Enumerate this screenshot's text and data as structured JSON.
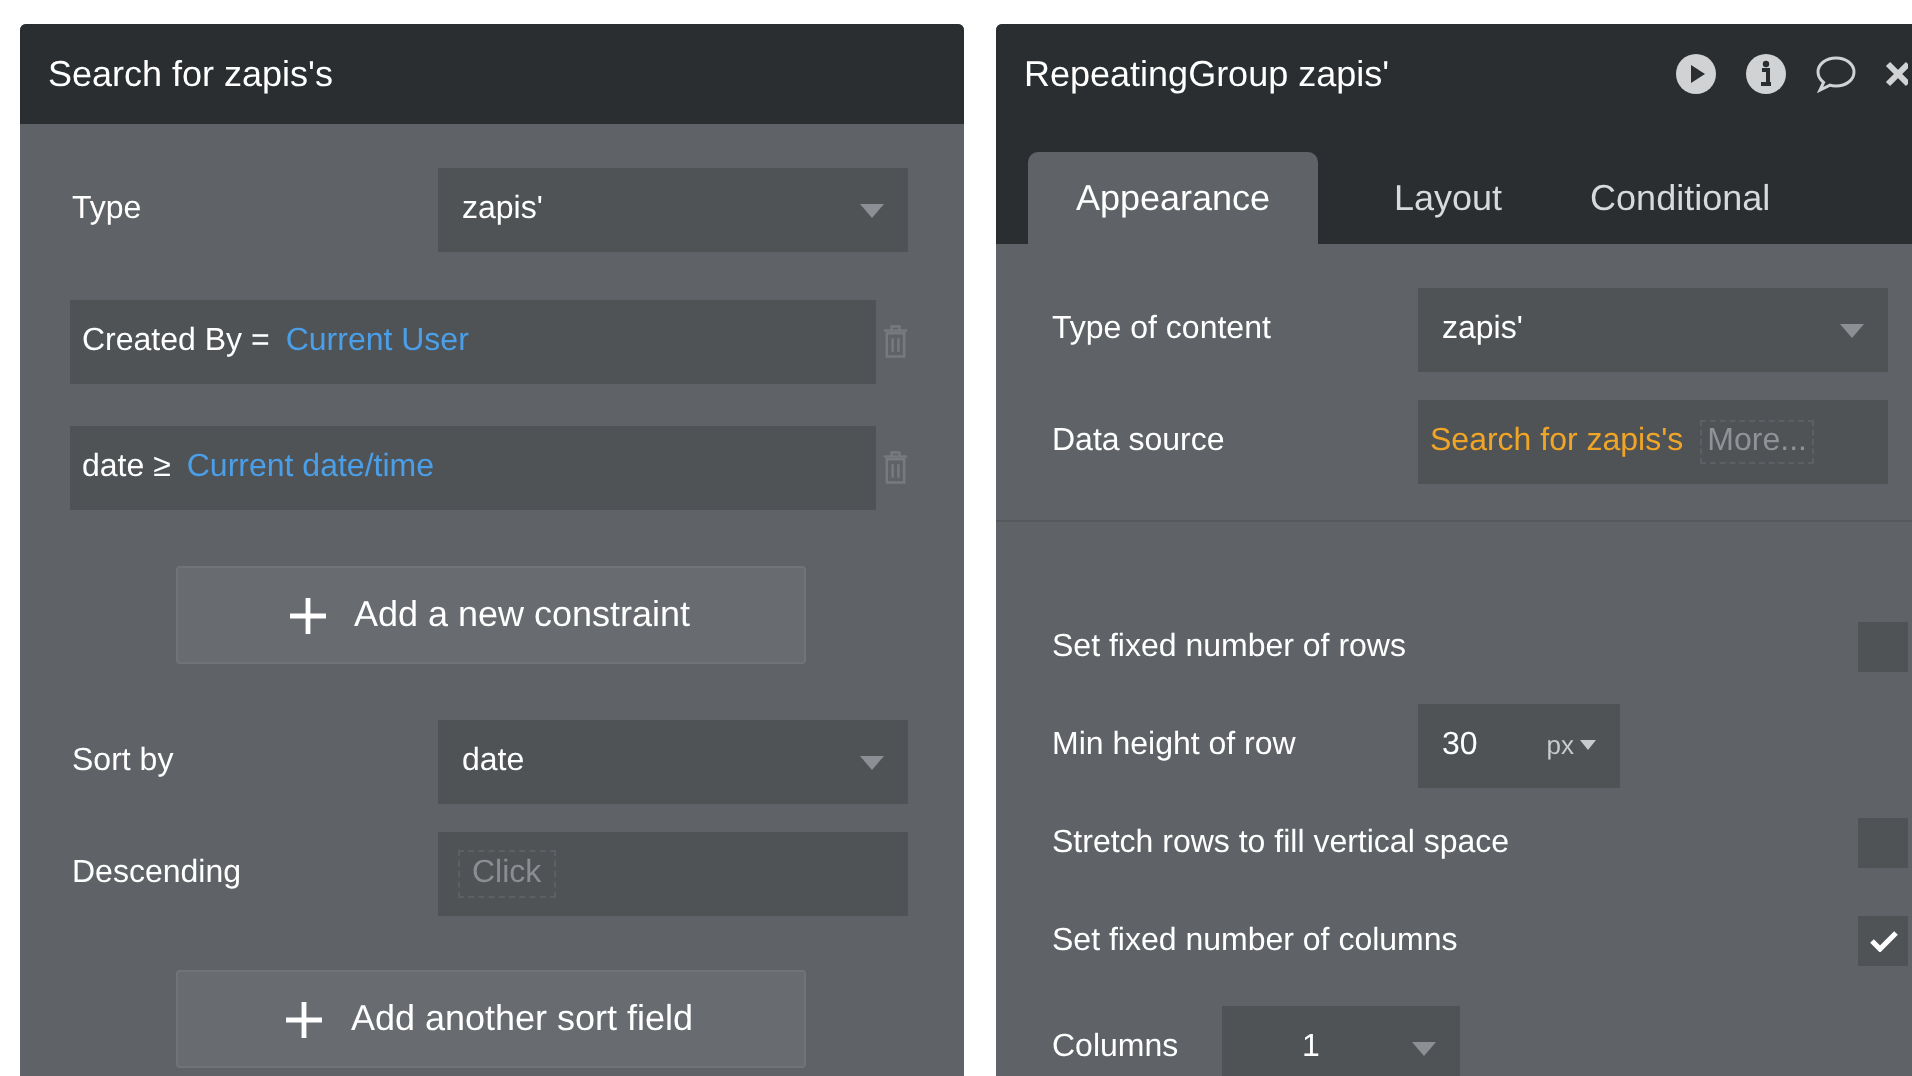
{
  "search_panel": {
    "title": "Search for zapis's",
    "type": {
      "label": "Type",
      "value": "zapis'"
    },
    "constraints": [
      {
        "label": "Created By =",
        "value": "Current User"
      },
      {
        "label": "date ≥",
        "value": "Current date/time"
      }
    ],
    "add_constraint_button": "Add a new constraint",
    "sort_by": {
      "label": "Sort by",
      "value": "date"
    },
    "descending": {
      "label": "Descending",
      "value": "Click"
    },
    "add_sort_button": "Add another sort field"
  },
  "element_panel": {
    "title": "RepeatingGroup zapis'",
    "tabs": [
      {
        "label": "Appearance",
        "selected": true
      },
      {
        "label": "Layout",
        "selected": false
      },
      {
        "label": "Conditional",
        "selected": false
      }
    ],
    "type_of_content": {
      "label": "Type of content",
      "value": "zapis'"
    },
    "data_source": {
      "label": "Data source",
      "value": "Search for zapis's",
      "more": "More..."
    },
    "options": [
      {
        "kind": "checkbox",
        "label": "Set fixed number of rows",
        "checked": false
      },
      {
        "kind": "unit",
        "label": "Min height of row",
        "value": "30",
        "unit": "px"
      },
      {
        "kind": "checkbox",
        "label": "Stretch rows to fill vertical space",
        "checked": false
      },
      {
        "kind": "checkbox",
        "label": "Set fixed number of columns",
        "checked": true
      },
      {
        "kind": "select",
        "label": "Columns",
        "value": "1"
      }
    ]
  }
}
